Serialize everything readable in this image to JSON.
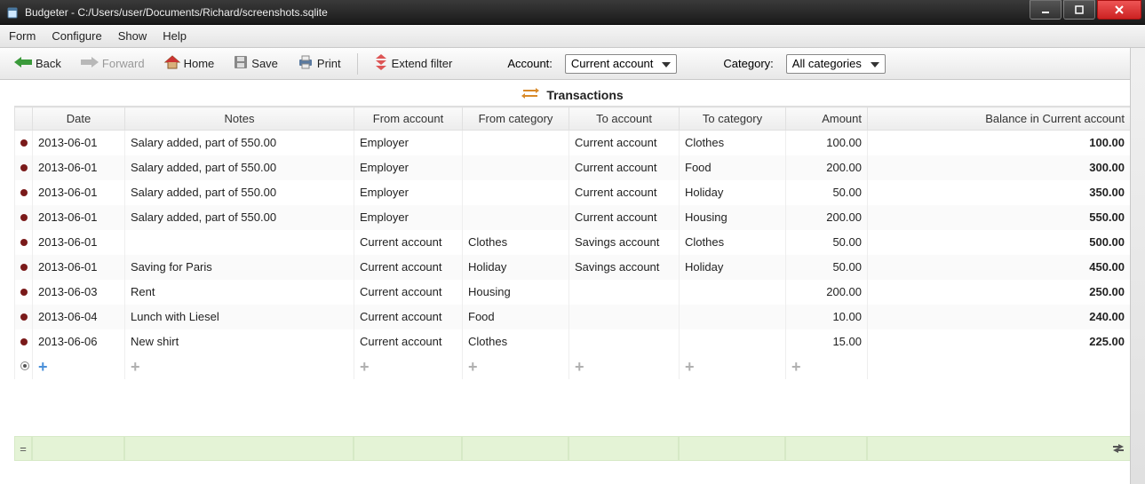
{
  "window": {
    "title": "Budgeter - C:/Users/user/Documents/Richard/screenshots.sqlite"
  },
  "menu": {
    "form": "Form",
    "configure": "Configure",
    "show": "Show",
    "help": "Help"
  },
  "toolbar": {
    "back": "Back",
    "forward": "Forward",
    "home": "Home",
    "save": "Save",
    "print": "Print",
    "extend_filter": "Extend filter",
    "account_label": "Account:",
    "account_value": "Current account",
    "category_label": "Category:",
    "category_value": "All categories"
  },
  "section": {
    "title": "Transactions"
  },
  "headers": {
    "date": "Date",
    "notes": "Notes",
    "from_account": "From account",
    "from_category": "From category",
    "to_account": "To account",
    "to_category": "To category",
    "amount": "Amount",
    "balance": "Balance in Current account"
  },
  "rows": [
    {
      "date": "2013-06-01",
      "notes": "Salary added, part of 550.00",
      "from_acc": "Employer",
      "from_cat": "",
      "to_acc": "Current account",
      "to_cat": "Clothes",
      "amount": "100.00",
      "balance": "100.00"
    },
    {
      "date": "2013-06-01",
      "notes": "Salary added, part of 550.00",
      "from_acc": "Employer",
      "from_cat": "",
      "to_acc": "Current account",
      "to_cat": "Food",
      "amount": "200.00",
      "balance": "300.00"
    },
    {
      "date": "2013-06-01",
      "notes": "Salary added, part of 550.00",
      "from_acc": "Employer",
      "from_cat": "",
      "to_acc": "Current account",
      "to_cat": "Holiday",
      "amount": "50.00",
      "balance": "350.00"
    },
    {
      "date": "2013-06-01",
      "notes": "Salary added, part of 550.00",
      "from_acc": "Employer",
      "from_cat": "",
      "to_acc": "Current account",
      "to_cat": "Housing",
      "amount": "200.00",
      "balance": "550.00"
    },
    {
      "date": "2013-06-01",
      "notes": "",
      "from_acc": "Current account",
      "from_cat": "Clothes",
      "to_acc": "Savings account",
      "to_cat": "Clothes",
      "amount": "50.00",
      "balance": "500.00"
    },
    {
      "date": "2013-06-01",
      "notes": "Saving for Paris",
      "from_acc": "Current account",
      "from_cat": "Holiday",
      "to_acc": "Savings account",
      "to_cat": "Holiday",
      "amount": "50.00",
      "balance": "450.00"
    },
    {
      "date": "2013-06-03",
      "notes": "Rent",
      "from_acc": "Current account",
      "from_cat": "Housing",
      "to_acc": "",
      "to_cat": "",
      "amount": "200.00",
      "balance": "250.00"
    },
    {
      "date": "2013-06-04",
      "notes": "Lunch with Liesel",
      "from_acc": "Current account",
      "from_cat": "Food",
      "to_acc": "",
      "to_cat": "",
      "amount": "10.00",
      "balance": "240.00"
    },
    {
      "date": "2013-06-06",
      "notes": "New shirt",
      "from_acc": "Current account",
      "from_cat": "Clothes",
      "to_acc": "",
      "to_cat": "",
      "amount": "15.00",
      "balance": "225.00"
    }
  ],
  "footer": {
    "equals": "="
  }
}
